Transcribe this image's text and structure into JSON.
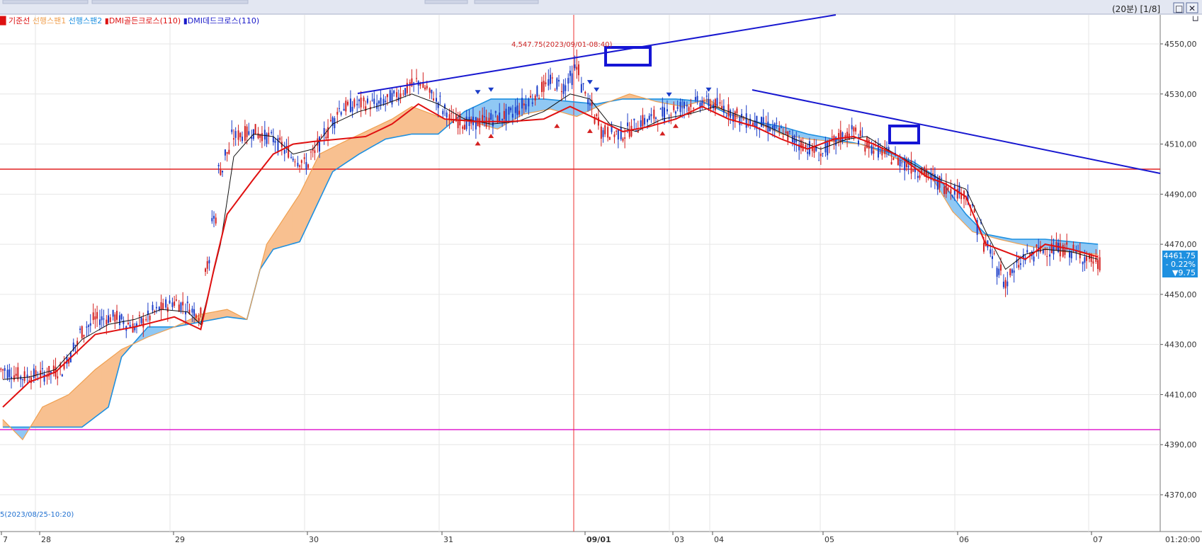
{
  "header": {
    "legend": [
      {
        "label": "기준선",
        "color": "#dd1111",
        "prefix": "█ "
      },
      {
        "label": "선행스팬1",
        "color": "#f0a050",
        "prefix": ""
      },
      {
        "label": "선행스팬2",
        "color": "#1e90e0",
        "prefix": ""
      },
      {
        "label": "DMI골든크로스(110)",
        "color": "#dd1111",
        "prefix": "▮"
      },
      {
        "label": "DMI데드크로스(110)",
        "color": "#1818c8",
        "prefix": "▮"
      }
    ],
    "period_label": "(20분) [1/8]",
    "controls": [
      "□",
      "✕"
    ],
    "corner_label": "└┘"
  },
  "price_box": {
    "price": "4461.75",
    "change_pct": "- 0.22%",
    "change_pts": "▼9.75"
  },
  "annotations": {
    "high_label": "4,547.75(2023/09/01-08:40)",
    "low_label": "5(2023/08/25-10:20)"
  },
  "colors": {
    "bull": "#d42020",
    "bear": "#1a3cc8",
    "kijun": "#e01010",
    "tenkan": "#111111",
    "span1": "#f0a050",
    "span2": "#1e90e0",
    "cloud_orange": "#f8c090",
    "cloud_blue": "#90c8f4",
    "trend_line": "#1818d0",
    "red_hline": "#e02020",
    "magenta_hline": "#e020d0",
    "grid": "#e6e6e6"
  },
  "chart_data": {
    "type": "candlestick-ichimoku",
    "y_axis_side": "right",
    "ylim": [
      4362,
      4565
    ],
    "yticks": [
      4550,
      4530,
      4510,
      4490,
      4470,
      4450,
      4430,
      4410,
      4390,
      4370
    ],
    "ytick_labels": [
      "4550,00",
      "4530,00",
      "4510,00",
      "4490,00",
      "4470,00",
      "4450,00",
      "4430,00",
      "4410,00",
      "4390,00",
      "4370,00"
    ],
    "x_axis_labels": [
      "7",
      "28",
      "29",
      "30",
      "31",
      "09/01",
      "03",
      "04",
      "05",
      "06",
      "07"
    ],
    "x_axis_end_label": "01:20:00",
    "horizontal_lines": [
      4500,
      4396
    ],
    "vertical_marker": "09/01",
    "last_price": 4461.75,
    "high_marker": {
      "value": 4547.75,
      "time": "2023/09/01-08:40"
    },
    "price_path": [
      [
        0,
        4420
      ],
      [
        3,
        4417
      ],
      [
        6,
        4418
      ],
      [
        9,
        4420
      ],
      [
        12,
        4435
      ],
      [
        14,
        4440
      ],
      [
        17,
        4441
      ],
      [
        20,
        4437
      ],
      [
        23,
        4443
      ],
      [
        26,
        4447
      ],
      [
        28,
        4445
      ],
      [
        30,
        4442
      ],
      [
        33,
        4500
      ],
      [
        35,
        4513
      ],
      [
        38,
        4515
      ],
      [
        41,
        4512
      ],
      [
        44,
        4505
      ],
      [
        46,
        4502
      ],
      [
        48,
        4510
      ],
      [
        51,
        4524
      ],
      [
        54,
        4526
      ],
      [
        57,
        4526
      ],
      [
        60,
        4530
      ],
      [
        63,
        4535
      ],
      [
        66,
        4527
      ],
      [
        68,
        4520
      ],
      [
        71,
        4518
      ],
      [
        74,
        4520
      ],
      [
        77,
        4522
      ],
      [
        80,
        4528
      ],
      [
        83,
        4535
      ],
      [
        85,
        4533
      ],
      [
        87,
        4540
      ],
      [
        89,
        4525
      ],
      [
        91,
        4515
      ],
      [
        94,
        4514
      ],
      [
        97,
        4519
      ],
      [
        100,
        4522
      ],
      [
        103,
        4525
      ],
      [
        106,
        4527
      ],
      [
        109,
        4525
      ],
      [
        112,
        4520
      ],
      [
        115,
        4518
      ],
      [
        118,
        4515
      ],
      [
        121,
        4510
      ],
      [
        124,
        4506
      ],
      [
        127,
        4513
      ],
      [
        129,
        4515
      ],
      [
        131,
        4510
      ],
      [
        134,
        4506
      ],
      [
        137,
        4502
      ],
      [
        140,
        4498
      ],
      [
        143,
        4493
      ],
      [
        146,
        4490
      ],
      [
        149,
        4470
      ],
      [
        152,
        4455
      ],
      [
        155,
        4465
      ],
      [
        158,
        4468
      ],
      [
        161,
        4468
      ],
      [
        164,
        4465
      ],
      [
        166,
        4462
      ]
    ],
    "kijun_path": [
      [
        0,
        4405
      ],
      [
        4,
        4415
      ],
      [
        8,
        4419
      ],
      [
        14,
        4434
      ],
      [
        20,
        4437
      ],
      [
        26,
        4441
      ],
      [
        30,
        4436
      ],
      [
        32,
        4460
      ],
      [
        34,
        4482
      ],
      [
        38,
        4496
      ],
      [
        41,
        4506
      ],
      [
        44,
        4510
      ],
      [
        47,
        4511
      ],
      [
        51,
        4512
      ],
      [
        55,
        4513
      ],
      [
        59,
        4518
      ],
      [
        63,
        4526
      ],
      [
        67,
        4520
      ],
      [
        72,
        4519
      ],
      [
        77,
        4519
      ],
      [
        82,
        4520
      ],
      [
        86,
        4525
      ],
      [
        90,
        4520
      ],
      [
        94,
        4515
      ],
      [
        98,
        4517
      ],
      [
        102,
        4520
      ],
      [
        106,
        4525
      ],
      [
        110,
        4520
      ],
      [
        114,
        4517
      ],
      [
        118,
        4512
      ],
      [
        122,
        4508
      ],
      [
        126,
        4512
      ],
      [
        129,
        4513
      ],
      [
        132,
        4510
      ],
      [
        136,
        4505
      ],
      [
        140,
        4497
      ],
      [
        143,
        4494
      ],
      [
        146,
        4489
      ],
      [
        149,
        4470
      ],
      [
        152,
        4467
      ],
      [
        155,
        4464
      ],
      [
        158,
        4470
      ],
      [
        162,
        4468
      ],
      [
        166,
        4465
      ]
    ],
    "tenkan_path": [
      [
        0,
        4416
      ],
      [
        4,
        4417
      ],
      [
        8,
        4420
      ],
      [
        12,
        4432
      ],
      [
        16,
        4438
      ],
      [
        20,
        4440
      ],
      [
        24,
        4444
      ],
      [
        28,
        4443
      ],
      [
        30,
        4438
      ],
      [
        33,
        4470
      ],
      [
        35,
        4505
      ],
      [
        38,
        4514
      ],
      [
        41,
        4513
      ],
      [
        44,
        4506
      ],
      [
        47,
        4508
      ],
      [
        50,
        4518
      ],
      [
        54,
        4523
      ],
      [
        58,
        4526
      ],
      [
        62,
        4530
      ],
      [
        66,
        4526
      ],
      [
        70,
        4520
      ],
      [
        74,
        4518
      ],
      [
        78,
        4519
      ],
      [
        82,
        4523
      ],
      [
        86,
        4530
      ],
      [
        89,
        4528
      ],
      [
        92,
        4518
      ],
      [
        96,
        4515
      ],
      [
        100,
        4520
      ],
      [
        104,
        4522
      ],
      [
        108,
        4525
      ],
      [
        112,
        4521
      ],
      [
        116,
        4517
      ],
      [
        120,
        4512
      ],
      [
        124,
        4508
      ],
      [
        128,
        4512
      ],
      [
        131,
        4513
      ],
      [
        134,
        4508
      ],
      [
        138,
        4502
      ],
      [
        142,
        4496
      ],
      [
        146,
        4492
      ],
      [
        149,
        4475
      ],
      [
        152,
        4460
      ],
      [
        155,
        4466
      ],
      [
        158,
        4468
      ],
      [
        162,
        4467
      ],
      [
        166,
        4464
      ]
    ],
    "span1_path": [
      [
        0,
        4400
      ],
      [
        3,
        4392
      ],
      [
        6,
        4405
      ],
      [
        10,
        4410
      ],
      [
        14,
        4420
      ],
      [
        18,
        4428
      ],
      [
        22,
        4433
      ],
      [
        26,
        4437
      ],
      [
        30,
        4442
      ],
      [
        34,
        4444
      ],
      [
        37,
        4440
      ],
      [
        40,
        4470
      ],
      [
        43,
        4482
      ],
      [
        45,
        4490
      ],
      [
        48,
        4506
      ],
      [
        51,
        4510
      ],
      [
        55,
        4515
      ],
      [
        59,
        4520
      ],
      [
        62,
        4525
      ],
      [
        67,
        4520
      ],
      [
        71,
        4519
      ],
      [
        75,
        4516
      ],
      [
        79,
        4522
      ],
      [
        83,
        4524
      ],
      [
        87,
        4521
      ],
      [
        91,
        4526
      ],
      [
        95,
        4530
      ],
      [
        99,
        4527
      ],
      [
        103,
        4525
      ],
      [
        107,
        4528
      ],
      [
        110,
        4522
      ],
      [
        114,
        4519
      ],
      [
        118,
        4514
      ],
      [
        122,
        4512
      ],
      [
        126,
        4511
      ],
      [
        130,
        4510
      ],
      [
        134,
        4506
      ],
      [
        138,
        4501
      ],
      [
        141,
        4496
      ],
      [
        144,
        4483
      ],
      [
        147,
        4475
      ],
      [
        151,
        4472
      ],
      [
        156,
        4469
      ],
      [
        161,
        4467
      ],
      [
        166,
        4466
      ]
    ],
    "span2_path": [
      [
        0,
        4397
      ],
      [
        4,
        4397
      ],
      [
        8,
        4397
      ],
      [
        12,
        4397
      ],
      [
        16,
        4405
      ],
      [
        18,
        4425
      ],
      [
        22,
        4437
      ],
      [
        26,
        4437
      ],
      [
        30,
        4439
      ],
      [
        34,
        4441
      ],
      [
        37,
        4440
      ],
      [
        39,
        4460
      ],
      [
        41,
        4468
      ],
      [
        45,
        4471
      ],
      [
        50,
        4499
      ],
      [
        54,
        4506
      ],
      [
        58,
        4512
      ],
      [
        62,
        4514
      ],
      [
        66,
        4514
      ],
      [
        70,
        4523
      ],
      [
        74,
        4528
      ],
      [
        78,
        4528
      ],
      [
        82,
        4528
      ],
      [
        86,
        4527
      ],
      [
        90,
        4526
      ],
      [
        94,
        4528
      ],
      [
        98,
        4528
      ],
      [
        102,
        4528
      ],
      [
        106,
        4527
      ],
      [
        110,
        4522
      ],
      [
        114,
        4519
      ],
      [
        118,
        4517
      ],
      [
        122,
        4514
      ],
      [
        126,
        4512
      ],
      [
        130,
        4510
      ],
      [
        134,
        4507
      ],
      [
        138,
        4503
      ],
      [
        142,
        4496
      ],
      [
        146,
        4482
      ],
      [
        149,
        4474
      ],
      [
        153,
        4472
      ],
      [
        158,
        4472
      ],
      [
        162,
        4471
      ],
      [
        166,
        4470
      ]
    ]
  }
}
